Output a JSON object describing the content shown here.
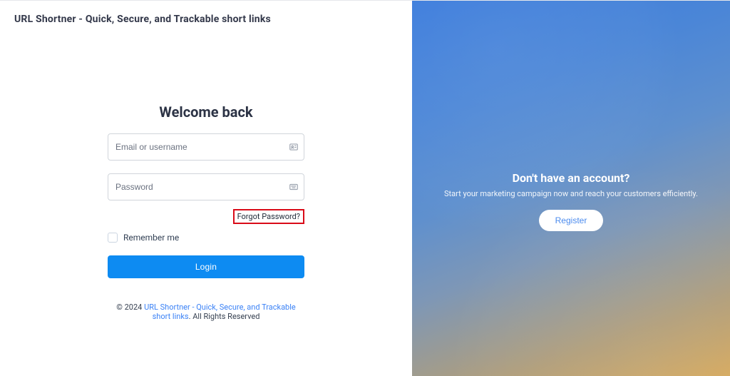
{
  "brand": {
    "title": "URL Shortner - Quick, Secure, and Trackable short links"
  },
  "login": {
    "heading": "Welcome back",
    "email_placeholder": "Email or username",
    "password_placeholder": "Password",
    "forgot_label": "Forgot Password?",
    "remember_label": "Remember me",
    "submit_label": "Login"
  },
  "footer": {
    "prefix": "© 2024 ",
    "link_text": "URL Shortner - Quick, Secure, and Trackable short links",
    "suffix": ". All Rights Reserved"
  },
  "promo": {
    "heading": "Don't have an account?",
    "subtext": "Start your marketing campaign now and reach your customers efficiently.",
    "register_label": "Register"
  }
}
